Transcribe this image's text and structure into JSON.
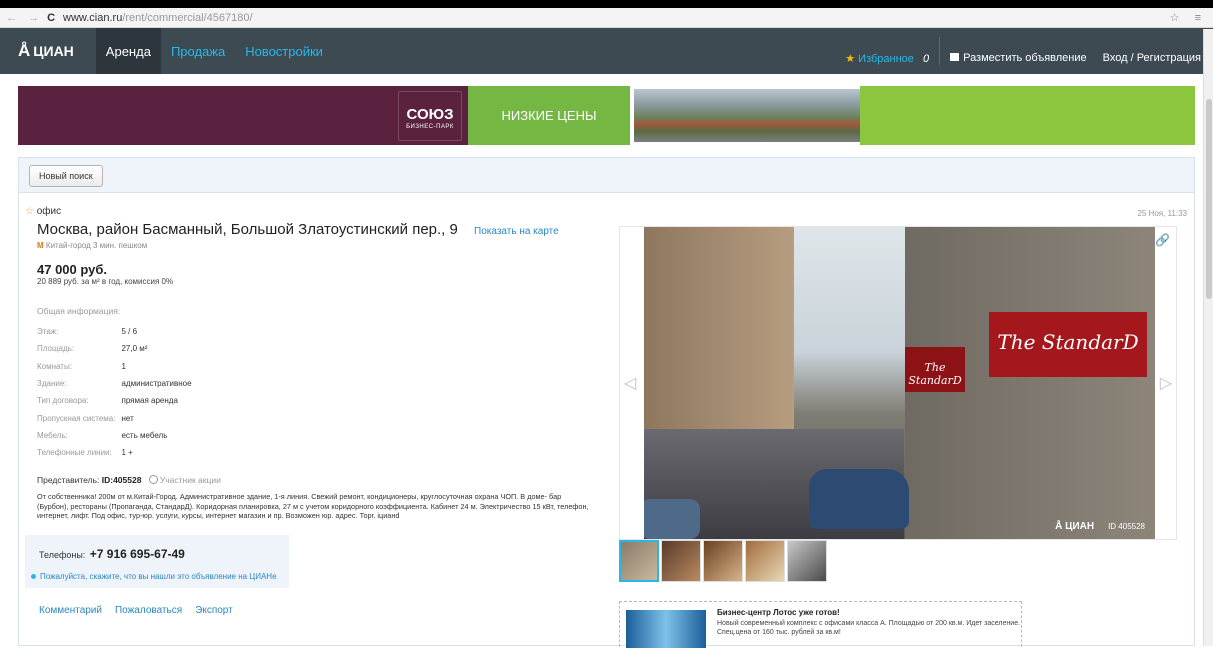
{
  "browser": {
    "back": "←",
    "forward": "→",
    "reload": "C",
    "url_host": "www.cian.ru",
    "url_path": "/rent/commercial/4567180/",
    "star": "☆",
    "menu": "≡"
  },
  "header": {
    "logo_mark": "Å",
    "logo_text": "ЦИАН",
    "tabs": [
      {
        "label": "Аренда",
        "active": true
      },
      {
        "label": "Продажа",
        "active": false
      },
      {
        "label": "Новостройки",
        "active": false
      }
    ],
    "favorites_label": "Избранное",
    "favorites_count": "0",
    "post_ad_label": "Разместить объявление",
    "login_label": "Вход / Регистрация"
  },
  "banner": {
    "logo_text": "СОЮЗ",
    "logo_sub": "БИЗНЕС-ПАРК",
    "slogan": "НИЗКИЕ ЦЕНЫ"
  },
  "search": {
    "new_search_label": "Новый поиск"
  },
  "listing": {
    "type": "офис",
    "address": "Москва, район Басманный, Большой Златоустинский пер., 9",
    "map_link": "Показать на карте",
    "metro": "Китай-город 3 мин. пешком",
    "price": "47 000 руб.",
    "price_per_m": "20 889 руб. за м² в год, комиссия 0%",
    "date": "25 Ноя, 11:33",
    "info_heading": "Общая информация:",
    "params": [
      {
        "key": "Этаж:",
        "value": "5 / 6"
      },
      {
        "key": "Площадь:",
        "value": "27,0 м²"
      },
      {
        "key": "Комнаты:",
        "value": "1"
      },
      {
        "key": "Здание:",
        "value": "административное"
      },
      {
        "key": "Тип договора:",
        "value": "прямая аренда"
      },
      {
        "key": "Пропускная система:",
        "value": "нет"
      },
      {
        "key": "Мебель:",
        "value": "есть мебель"
      },
      {
        "key": "Телефонные линии:",
        "value": "1 +"
      }
    ],
    "rep_label": "Представитель:",
    "rep_id": "ID:405528",
    "rep_badge": "Участник акции",
    "description": "От собственника! 200м от м.Китай-Город. Административное здание, 1-я линия. Свежий ремонт, кондиционеры, круглосуточная охрана ЧОП. В доме- бар (Бурбон), рестораны (Пропаганда, СтандарД). Коридорная планировка, 27 м с учетом коридорного коэффициента. Кабинет 24 м. Электричество 15 кВт, телефон, интернет, лифт. Под офис, тур-юр. услуги, курсы, интернет магазин и пр. Возможен юр. адрес. Торг. iцианd",
    "phone_label": "Телефоны:",
    "phone": "+7 916 695-67-49",
    "phone_note": "Пожалуйста, скажите, что вы нашли это объявление на ЦИАНе",
    "actions": [
      "Комментарий",
      "Пожаловаться",
      "Экспорт"
    ]
  },
  "gallery": {
    "sign_main": "The StandarD",
    "sign_small": "The StandarD",
    "watermark_logo": "Å ЦИАН",
    "watermark_id": "ID 405528",
    "prev": "◁",
    "next": "▷",
    "link_icon": "🔗"
  },
  "ad": {
    "title": "Бизнес-центр Лотос уже готов!",
    "text": "Новый современный комплекс с офисами класса А. Площадью от 200 кв.м. Идет заселение. Спец.цена от 160 тыс. рублей за кв.м!"
  }
}
